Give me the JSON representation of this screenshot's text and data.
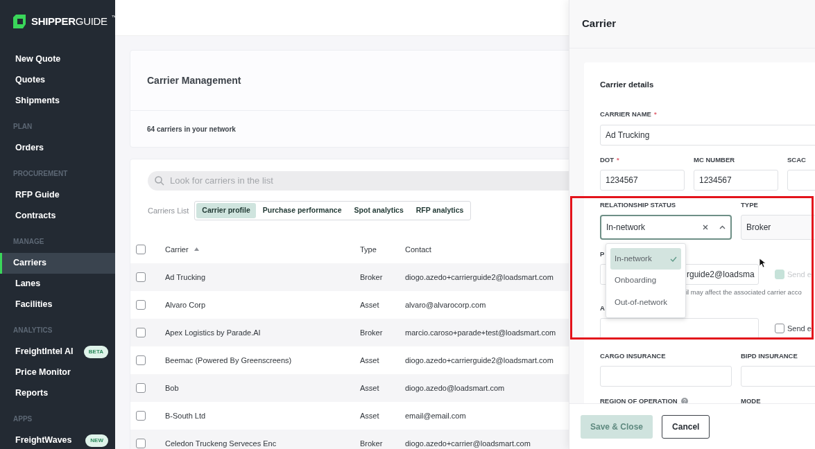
{
  "logo": {
    "text": "**SHIPPER**GUIDE",
    "mark": "™"
  },
  "sidebar": {
    "sections": [
      {
        "items": [
          {
            "label": "New Quote",
            "selected": false
          },
          {
            "label": "Quotes",
            "selected": false
          },
          {
            "label": "Shipments",
            "selected": false
          }
        ]
      },
      {
        "heading": "PLAN",
        "items": [
          {
            "label": "Orders",
            "selected": false
          }
        ]
      },
      {
        "heading": "PROCUREMENT",
        "items": [
          {
            "label": "RFP Guide",
            "selected": false
          },
          {
            "label": "Contracts",
            "selected": false
          }
        ]
      },
      {
        "heading": "MANAGE",
        "items": [
          {
            "label": "Carriers",
            "selected": true
          },
          {
            "label": "Lanes",
            "selected": false
          },
          {
            "label": "Facilities",
            "selected": false
          }
        ]
      },
      {
        "heading": "ANALYTICS",
        "items": [
          {
            "label": "FreightIntel AI",
            "selected": false,
            "badge": "BETA"
          },
          {
            "label": "Price Monitor",
            "selected": false
          },
          {
            "label": "Reports",
            "selected": false
          }
        ]
      },
      {
        "heading": "APPS",
        "items": [
          {
            "label": "FreightWaves",
            "selected": false,
            "badge": "NEW"
          }
        ]
      }
    ]
  },
  "page": {
    "title": "Carrier Management",
    "summary": "64 carriers in your network",
    "search": {
      "placeholder": "Look for carriers in the list"
    },
    "views_label": "Carriers List",
    "views": [
      {
        "label": "Carrier profile",
        "selected": true
      },
      {
        "label": "Purchase performance",
        "selected": false
      },
      {
        "label": "Spot analytics",
        "selected": false
      },
      {
        "label": "RFP analytics",
        "selected": false
      }
    ],
    "table": {
      "all_checked": false,
      "columns": [
        {
          "label": "Carrier",
          "sorted": true
        },
        {
          "label": "Type",
          "sorted": false
        },
        {
          "label": "Contact",
          "sorted": false
        }
      ],
      "rows": [
        {
          "checked": false,
          "carrier": "Ad Trucking",
          "type": "Broker",
          "contact": "diogo.azedo+carrierguide2@loadsmart.com"
        },
        {
          "checked": false,
          "carrier": "Alvaro Corp",
          "type": "Asset",
          "contact": "alvaro@alvarocorp.com"
        },
        {
          "checked": false,
          "carrier": "Apex Logistics by Parade.AI",
          "type": "Broker",
          "contact": "marcio.caroso+parade+test@loadsmart.com"
        },
        {
          "checked": false,
          "carrier": "Beemac (Powered By Greenscreens)",
          "type": "Asset",
          "contact": "diogo.azedo+carrierguide2@loadsmart.com"
        },
        {
          "checked": false,
          "carrier": "Bob",
          "type": "Asset",
          "contact": "diogo.azedo@loadsmart.com"
        },
        {
          "checked": false,
          "carrier": "B-South Ltd",
          "type": "Asset",
          "contact": "email@email.com"
        },
        {
          "checked": false,
          "carrier": "Celedon Truckeng Serveces Enc",
          "type": "Broker",
          "contact": "diogo.azedo+carrier@loadsmart.com"
        }
      ]
    }
  },
  "drawer": {
    "title": "Carrier",
    "section_title": "Carrier details",
    "carrier_name": {
      "label": "CARRIER NAME",
      "required_mark": "*",
      "value": "Ad Trucking"
    },
    "dot": {
      "label": "DOT",
      "required_mark": "*",
      "value": "1234567"
    },
    "mc_number": {
      "label": "MC NUMBER",
      "value": "1234567"
    },
    "scac": {
      "label": "SCAC"
    },
    "relationship_status": {
      "label": "RELATIONSHIP STATUS",
      "value": "In-network",
      "expanded": true,
      "options": [
        {
          "label": "In-network",
          "selected": true
        },
        {
          "label": "Onboarding",
          "selected": false
        },
        {
          "label": "Out-of-network",
          "selected": false
        }
      ]
    },
    "type": {
      "label": "TYPE",
      "value": "Broker"
    },
    "email": {
      "label": "P",
      "value": "rguide2@loadsma",
      "send_label": "Send e",
      "send_checked": true,
      "send_disabled": true,
      "hint": "il may affect the associated carrier acco"
    },
    "additional_email": {
      "label": "A",
      "send_label": "Send e",
      "send_checked": false,
      "send_disabled": false
    },
    "cargo_insurance": {
      "label": "CARGO INSURANCE"
    },
    "bipd_insurance": {
      "label": "BIPD INSURANCE"
    },
    "region": {
      "label": "REGION OF OPERATION",
      "help": true
    },
    "mode": {
      "label": "MODE"
    },
    "buttons": [
      {
        "label": "Save & Close",
        "kind": "primary",
        "disabled": true
      },
      {
        "label": "Cancel",
        "kind": "secondary",
        "disabled": false
      }
    ]
  }
}
